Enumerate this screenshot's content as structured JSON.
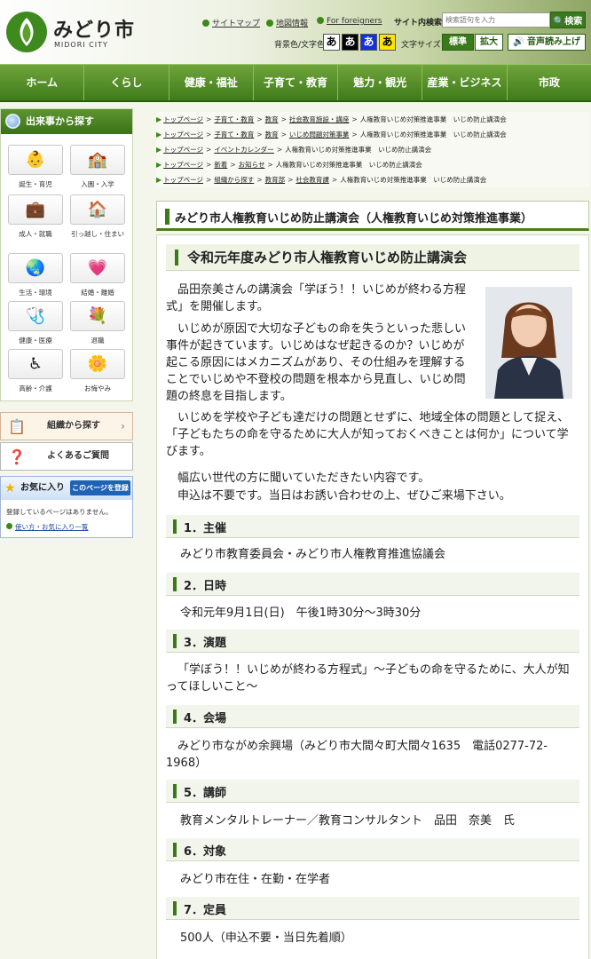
{
  "header": {
    "site_name": "みどり市",
    "site_name_en": "MIDORI CITY",
    "links": [
      "サイトマップ",
      "地図情報",
      "For foreigners"
    ],
    "search_label": "サイト内検索",
    "search_placeholder": "検索語句を入力",
    "search_button": "検索",
    "color_label": "背景色/文字色",
    "color_options": [
      "あ",
      "あ",
      "あ",
      "あ"
    ],
    "fontsize_label": "文字サイズ",
    "fontsize_standard": "標準",
    "fontsize_large": "拡大",
    "voice_button": "音声読み上げ"
  },
  "nav": [
    "ホーム",
    "くらし",
    "健康・福祉",
    "子育て・教育",
    "魅力・観光",
    "産業・ビジネス",
    "市政"
  ],
  "sidebar": {
    "event_title": "出来事から探す",
    "events": [
      {
        "label": "誕生・育児",
        "icon": "baby-icon"
      },
      {
        "label": "入園・入学",
        "icon": "school-icon"
      },
      {
        "label": "成人・就職",
        "icon": "briefcase-icon"
      },
      {
        "label": "引っ越し・住まい",
        "icon": "house-icon"
      },
      {
        "label": "生活・環境",
        "icon": "globe-icon"
      },
      {
        "label": "結婚・離婚",
        "icon": "heart-icon"
      },
      {
        "label": "健康・医療",
        "icon": "clipboard-icon"
      },
      {
        "label": "退職",
        "icon": "flower-icon"
      },
      {
        "label": "高齢・介護",
        "icon": "wheelchair-icon"
      },
      {
        "label": "お悔やみ",
        "icon": "chrysanthemum-icon"
      }
    ],
    "org_search": "組織から探す",
    "faq": "よくあるご質問",
    "favorites_title": "お気に入り",
    "favorites_register": "このページを登録",
    "favorites_empty": "登録しているページはありません。",
    "favorites_help": "使い方・お気に入り一覧"
  },
  "breadcrumbs": [
    {
      "links": [
        "トップページ",
        "子育て・教育",
        "教育",
        "社会教育施設・講座"
      ],
      "current": "人権教育いじめ対策推進事業　いじめ防止講演会"
    },
    {
      "links": [
        "トップページ",
        "子育て・教育",
        "教育",
        "いじめ問題対策事業"
      ],
      "current": "人権教育いじめ対策推進事業　いじめ防止講演会"
    },
    {
      "links": [
        "トップページ",
        "イベントカレンダー"
      ],
      "current": "人権教育いじめ対策推進事業　いじめ防止講演会"
    },
    {
      "links": [
        "トップページ",
        "新着",
        "お知らせ"
      ],
      "current": "人権教育いじめ対策推進事業　いじめ防止講演会"
    },
    {
      "links": [
        "トップページ",
        "組織から探す",
        "教育部",
        "社会教育課"
      ],
      "current": "人権教育いじめ対策推進事業　いじめ防止講演会"
    }
  ],
  "main": {
    "page_title": "みどり市人権教育いじめ防止講演会（人権教育いじめ対策推進事業）",
    "event_heading": "令和元年度みどり市人権教育いじめ防止講演会",
    "intro": [
      "品田奈美さんの講演会「学ぼう！！いじめが終わる方程式」を開催します。",
      "いじめが原因で大切な子どもの命を失うといった悲しい事件が起きています。いじめはなぜ起きるのか？いじめが起こる原因にはメカニズムがあり、その仕組みを理解することでいじめや不登校の問題を根本から見直し、いじめ問題の終息を目指します。",
      "いじめを学校や子ども達だけの問題とせずに、地域全体の問題として捉え、「子どもたちの命を守るために大人が知っておくべきことは何か」について学びます。",
      "幅広い世代の方に聞いていただきたい内容です。",
      "申込は不要です。当日はお誘い合わせの上、ぜひご来場下さい。"
    ],
    "sections": [
      {
        "label": "1．主催",
        "body": "みどり市教育委員会・みどり市人権教育推進協議会"
      },
      {
        "label": "2．日時",
        "body": "令和元年9月1日(日)　午後1時30分～3時30分"
      },
      {
        "label": "3．演題",
        "body": "「学ぼう！！いじめが終わる方程式」～子どもの命を守るために、大人が知ってほしいこと～"
      },
      {
        "label": "4．会場",
        "body": "みどり市ながめ余興場（みどり市大間々町大間々1635　電話0277-72-1968）"
      },
      {
        "label": "5．講師",
        "body": "教育メンタルトレーナー／教育コンサルタント　品田　奈美　氏"
      },
      {
        "label": "6．対象",
        "body": "みどり市在住・在勤・在学者"
      },
      {
        "label": "7．定員",
        "body": "500人（申込不要・当日先着順）"
      }
    ]
  }
}
